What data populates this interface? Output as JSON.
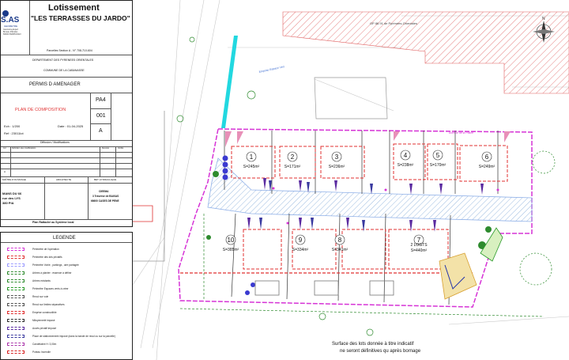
{
  "cartouche": {
    "logo_text": "S.AS",
    "logo_sub": "GEOMETRE",
    "logo_small": [
      "Géomètre-Expert",
      "Bureau d'Études",
      "66000 PERPIGNAN"
    ],
    "title": "Lotissement",
    "subtitle": "\"LES TERRASSES DU JARDO\"",
    "parcelles": "Parcelles Section A - N° 708-710-604",
    "departement": "DEPARTEMENT DES PYRENEES ORIENTALES",
    "commune": "COMMUNE DE LA CABANASSE",
    "permis": "PERMIS D AMENAGER",
    "plan_title": "PLAN DE COMPOSITION",
    "code": "PA4",
    "code_num": "001",
    "code_letter": "A",
    "echelle": "Ech : 1/200",
    "date": "Date : 01-04-2025",
    "ref": "Ref : 23011lot",
    "diffusion_header": "Diffusion / Modifications",
    "table_headers": [
      "Ind",
      "Définition des modifications",
      "Dessiné",
      "Vérifié"
    ],
    "table_rows": [
      "A"
    ],
    "moa_header": "MAÎTRE D'OUVRAGE",
    "architecte_header": "ARCHITECTE",
    "bet_header": "BET HYDRAULIQUE",
    "moa_lines": [
      "MANS DU 66",
      "rue des LYS",
      "380 PIA"
    ],
    "bet_lines": [
      "CIEEMA",
      "3 Traverse de BAIXAS",
      "66600 CASES DE PENE"
    ],
    "footer": "Plan Rattaché au Système local"
  },
  "legend": {
    "title": "LEGENDE",
    "items": [
      {
        "label": "Périmètre de l'opération",
        "color": "#d633d6"
      },
      {
        "label": "Périmètre des lots privatifs",
        "color": "#e03030"
      },
      {
        "label": "Périmètre Voirie , parkings , aire partagée",
        "color": "#9a9aff"
      },
      {
        "label": "Arbres à planter : essence à définir",
        "color": "#2e8b2e"
      },
      {
        "label": "Arbres existants",
        "color": "#2e8b2e"
      },
      {
        "label": "Périmètre Espaces verts à créer",
        "color": "#2a9a2a"
      },
      {
        "label": "Recul sur voie",
        "color": "#555555"
      },
      {
        "label": "Recul sur limites séparatives",
        "color": "#555555"
      },
      {
        "label": "Emprise constructible",
        "color": "#e03030"
      },
      {
        "label": "Mitoyenneté imposé",
        "color": "#333333"
      },
      {
        "label": "Accès privatif imposé",
        "color": "#5a2aa0"
      },
      {
        "label": "Place de stationnement imposé (dans la bande de recul ou sur la parcelle)",
        "color": "#3a3aa0"
      },
      {
        "label": "Candélabre H: 3,00m",
        "color": "#aa33aa"
      },
      {
        "label": "Poteau Incendie",
        "color": "#d62020"
      }
    ]
  },
  "plan": {
    "north_label": "N",
    "neighbor_label": "OP 86.91 de Pyrénées-Orientales",
    "road_label": "Avenue de la Plaine",
    "label_existing": "Emprise Espace Vert",
    "lots": [
      {
        "num": "1",
        "surface": "S=245m²"
      },
      {
        "num": "2",
        "surface": "S=171m²"
      },
      {
        "num": "3",
        "surface": "S=236m²"
      },
      {
        "num": "4",
        "surface": "S=238m²"
      },
      {
        "num": "5",
        "surface": "S=170m²"
      },
      {
        "num": "6",
        "surface": "S=249m²"
      },
      {
        "num": "7",
        "surface": "S=440m²",
        "extra": "2 LOGTS"
      },
      {
        "num": "8",
        "surface": "S=341m²"
      },
      {
        "num": "9",
        "surface": "S=334m²"
      },
      {
        "num": "10",
        "surface": "S=385m²"
      }
    ],
    "note_lines": [
      "Surface des lots donnée à titre indicatif",
      "ne seront définitives qu après bornage"
    ]
  },
  "colors": {
    "perimeter": "#d633d6",
    "lot_red": "#e03030",
    "road_blue": "#8fb0e8",
    "hatch": "#b0c8e8",
    "cyan_strip": "#22d8e0",
    "green": "#2e8b2e",
    "purple": "#5a2aa0"
  }
}
